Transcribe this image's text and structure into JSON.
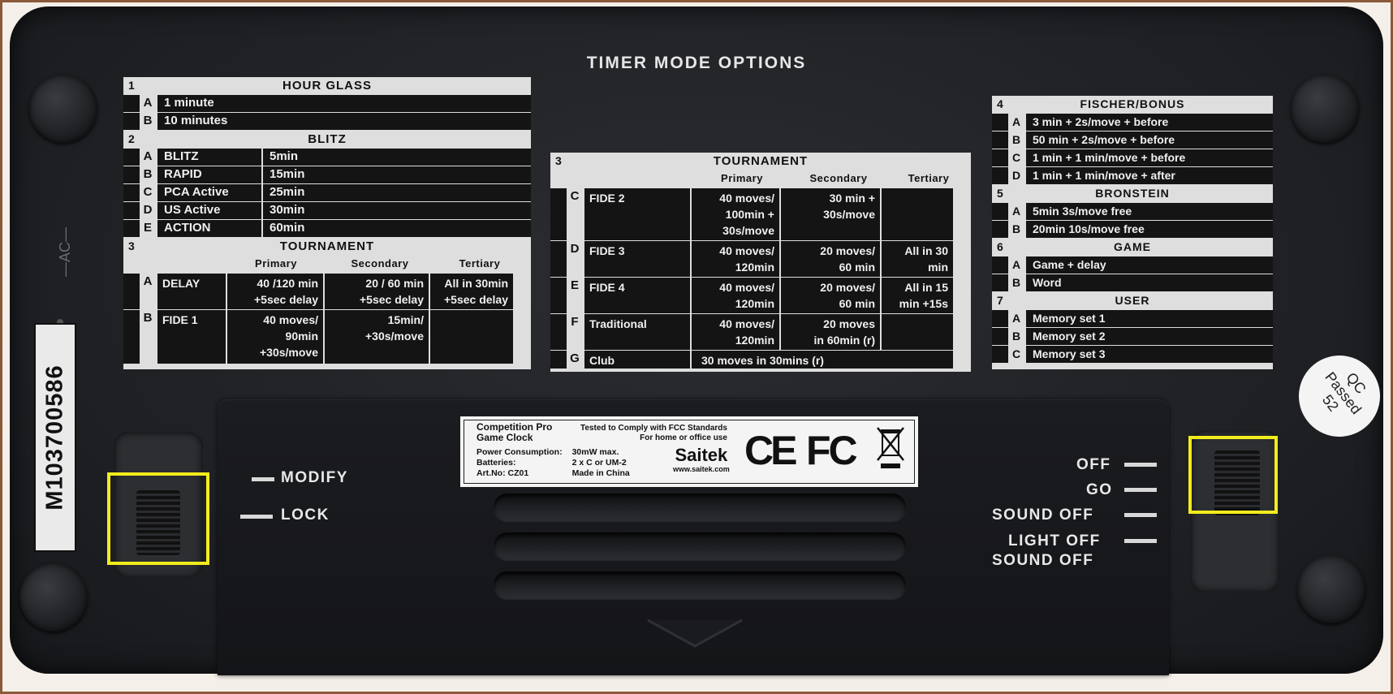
{
  "title": "TIMER MODE OPTIONS",
  "left_panel": {
    "sections": [
      {
        "num": "1",
        "name": "HOUR GLASS",
        "rows": [
          {
            "letter": "A",
            "label": "1 minute"
          },
          {
            "letter": "B",
            "label": "10 minutes"
          }
        ]
      },
      {
        "num": "2",
        "name": "BLITZ",
        "rows": [
          {
            "letter": "A",
            "label": "BLITZ",
            "value": "5min"
          },
          {
            "letter": "B",
            "label": "RAPID",
            "value": "15min"
          },
          {
            "letter": "C",
            "label": "PCA Active",
            "value": "25min"
          },
          {
            "letter": "D",
            "label": "US Active",
            "value": "30min"
          },
          {
            "letter": "E",
            "label": "ACTION",
            "value": "60min"
          }
        ]
      },
      {
        "num": "3",
        "name": "TOURNAMENT",
        "columns": [
          "Primary",
          "Secondary",
          "Tertiary"
        ],
        "rows": [
          {
            "letter": "A",
            "label": "DELAY",
            "primary": "40 /120 min\n+5sec delay",
            "secondary": "20 / 60 min\n+5sec delay",
            "tertiary": "All in 30min\n+5sec delay"
          },
          {
            "letter": "B",
            "label": "FIDE 1",
            "primary": "40 moves/\n90min\n+30s/move",
            "secondary": "15min/\n+30s/move",
            "tertiary": ""
          }
        ]
      }
    ]
  },
  "middle_panel": {
    "num": "3",
    "name": "TOURNAMENT",
    "columns": [
      "Primary",
      "Secondary",
      "Tertiary"
    ],
    "rows": [
      {
        "letter": "C",
        "label": "FIDE 2",
        "primary": "40 moves/\n100min +\n30s/move",
        "secondary": "30 min +\n30s/move",
        "tertiary": ""
      },
      {
        "letter": "D",
        "label": "FIDE 3",
        "primary": "40 moves/\n120min",
        "secondary": "20 moves/\n60 min",
        "tertiary": "All in 30\nmin"
      },
      {
        "letter": "E",
        "label": "FIDE 4",
        "primary": "40 moves/\n120min",
        "secondary": "20 moves/\n60 min",
        "tertiary": "All in 15\nmin +15s"
      },
      {
        "letter": "F",
        "label": "Traditional",
        "primary": "40 moves/\n120min",
        "secondary": "20 moves\nin 60min (r)",
        "tertiary": ""
      }
    ],
    "last_row": {
      "letter": "G",
      "label": "Club",
      "text": "30 moves in 30mins (r)"
    }
  },
  "right_panel": {
    "sections": [
      {
        "num": "4",
        "name": "FISCHER/BONUS",
        "rows": [
          {
            "letter": "A",
            "label": "3 min + 2s/move + before"
          },
          {
            "letter": "B",
            "label": "50 min + 2s/move + before"
          },
          {
            "letter": "C",
            "label": "1 min + 1 min/move + before"
          },
          {
            "letter": "D",
            "label": "1 min + 1 min/move + after"
          }
        ]
      },
      {
        "num": "5",
        "name": "BRONSTEIN",
        "rows": [
          {
            "letter": "A",
            "label": "5min 3s/move free"
          },
          {
            "letter": "B",
            "label": "20min 10s/move free"
          }
        ]
      },
      {
        "num": "6",
        "name": "GAME",
        "rows": [
          {
            "letter": "A",
            "label": "Game + delay"
          },
          {
            "letter": "B",
            "label": "Word"
          }
        ]
      },
      {
        "num": "7",
        "name": "USER",
        "rows": [
          {
            "letter": "A",
            "label": "Memory set 1"
          },
          {
            "letter": "B",
            "label": "Memory set 2"
          },
          {
            "letter": "C",
            "label": "Memory set 3"
          }
        ]
      }
    ]
  },
  "sticker": {
    "product_line1": "Competition Pro",
    "product_line2": "Game Clock",
    "fcc_line1": "Tested to Comply with FCC Standards",
    "fcc_line2": "For home or office use",
    "power_label": "Power Consumption:",
    "power_value": "30mW max.",
    "batteries_label": "Batteries:",
    "batteries_value": "2 x C or UM-2",
    "art_label": "Art.No:",
    "art_value": "CZ01",
    "made_in": "Made in China",
    "brand": "Saitek",
    "website": "www.saitek.com",
    "ce": "CE",
    "fc": "FC"
  },
  "serial": "M103700586",
  "side_mark": "—AC—",
  "qc": {
    "line1": "QC",
    "line2": "Passed",
    "line3": "52"
  },
  "left_switch": {
    "labels": [
      "MODIFY",
      "LOCK"
    ]
  },
  "right_switch": {
    "labels": [
      "OFF",
      "GO",
      "SOUND OFF",
      "LIGHT OFF",
      "SOUND OFF"
    ]
  },
  "highlight_color": "#f2ec1c"
}
